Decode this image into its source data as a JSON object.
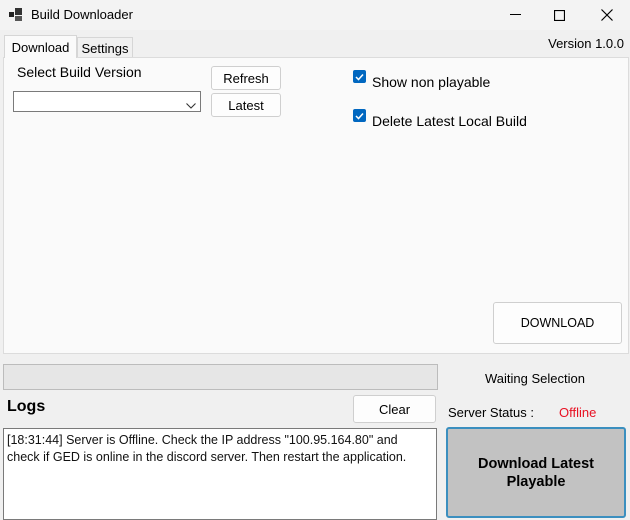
{
  "window": {
    "title": "Build Downloader",
    "icons": {
      "app": "app-icon",
      "minimize": "minimize-icon",
      "maximize": "maximize-icon",
      "close": "close-icon"
    }
  },
  "tabs": [
    {
      "label": "Download",
      "active": true
    },
    {
      "label": "Settings",
      "active": false
    }
  ],
  "version": "Version 1.0.0",
  "download_tab": {
    "select_build_label": "Select Build Version",
    "build_select_value": "",
    "refresh_button": "Refresh",
    "latest_button": "Latest",
    "show_non_playable": {
      "label": "Show non playable",
      "checked": true
    },
    "delete_latest_local": {
      "label": "Delete Latest Local Build",
      "checked": true
    },
    "download_button": "DOWNLOAD"
  },
  "progress": {
    "value": 0
  },
  "status_text": "Waiting Selection",
  "logs": {
    "title": "Logs",
    "clear_button": "Clear",
    "text": "[18:31:44] Server is Offline. Check the IP address \"100.95.164.80\" and check if GED is online in the discord server. Then restart the application."
  },
  "server_status": {
    "label": "Server Status :",
    "value": "Offline",
    "value_color": "#e81123"
  },
  "download_latest_button": "Download Latest Playable",
  "colors": {
    "accent": "#0067c0",
    "button_border_focus": "#3b8fbf"
  }
}
